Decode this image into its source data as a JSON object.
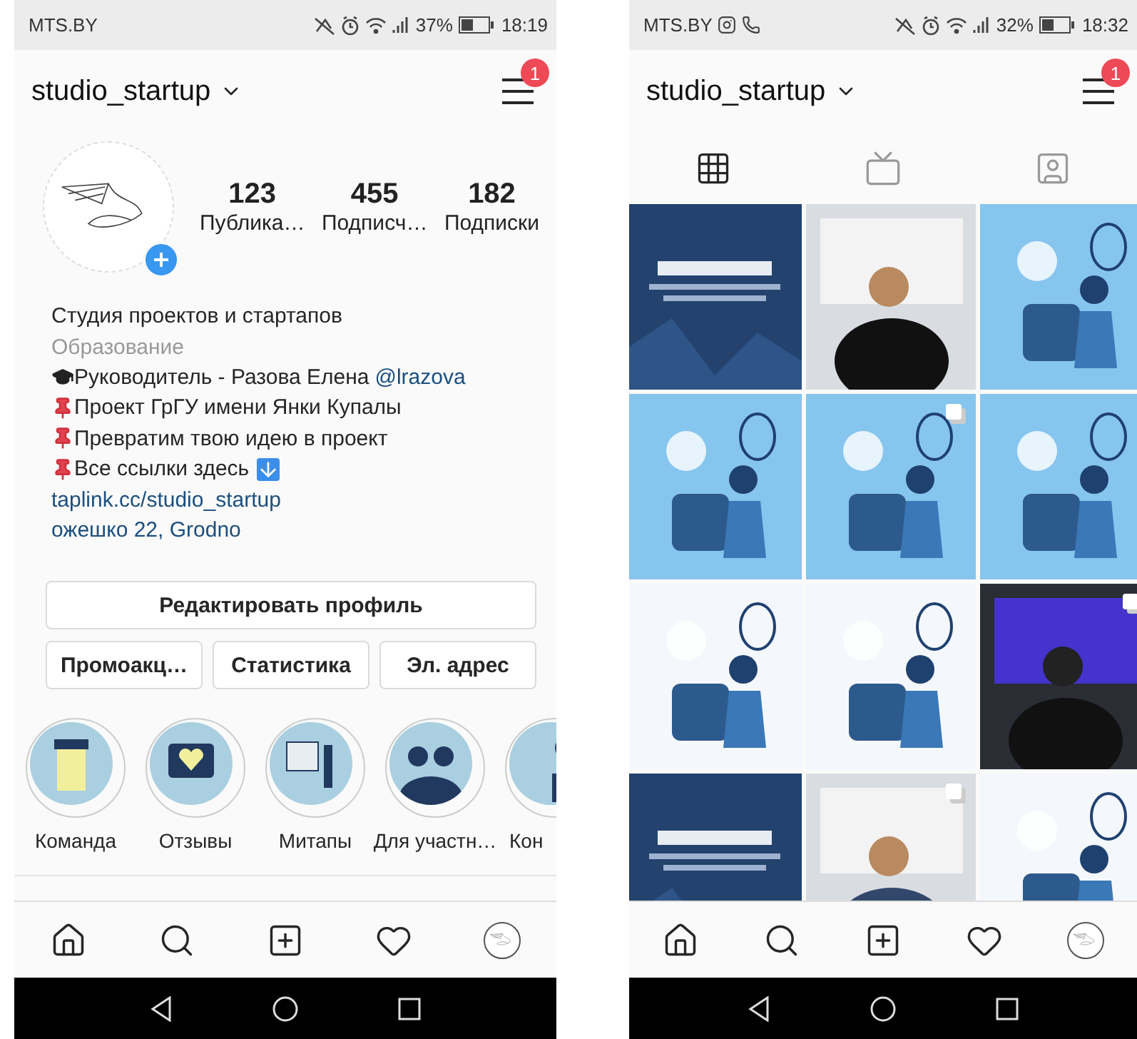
{
  "screens": [
    {
      "kind": "profile",
      "status_bar": {
        "carrier": "MTS.BY",
        "battery": "37%",
        "time": "18:19"
      },
      "header": {
        "username": "studio_startup",
        "badge": "1"
      },
      "stats": [
        {
          "value": "123",
          "label": "Публика…"
        },
        {
          "value": "455",
          "label": "Подписч…"
        },
        {
          "value": "182",
          "label": "Подписки"
        }
      ],
      "bio": [
        {
          "kind": "name",
          "text": "Студия проектов и стартапов"
        },
        {
          "kind": "category",
          "text": "Образование"
        },
        {
          "kind": "lead",
          "text": "Руководитель - Разова Елена",
          "mention": "@lrazova"
        },
        {
          "kind": "bullet",
          "text": "Проект ГрГУ имени Янки Купалы",
          "arrow": false
        },
        {
          "kind": "bullet",
          "text": "Превратим твою идею в проект",
          "arrow": false
        },
        {
          "kind": "bullet",
          "text": "Все ссылки здесь",
          "arrow": true
        },
        {
          "kind": "link",
          "text": "taplink.cc/studio_startup"
        },
        {
          "kind": "link",
          "text": "ожешко 22, Grodno"
        }
      ],
      "edit_button": "Редактировать профиль",
      "buttons": [
        "Промоакц…",
        "Статистика",
        "Эл. адрес"
      ],
      "highlights": [
        {
          "label": "Команда"
        },
        {
          "label": "Отзывы"
        },
        {
          "label": "Митапы"
        },
        {
          "label": "Для участн…"
        },
        {
          "label": "Кон"
        }
      ]
    },
    {
      "kind": "grid",
      "status_bar": {
        "carrier": "MTS.BY",
        "notifications": [
          {
            "kind": "camera"
          },
          {
            "kind": "phone"
          }
        ],
        "battery": "32%",
        "time": "18:32"
      },
      "header": {
        "username": "studio_startup",
        "badge": "1"
      },
      "tabs": [
        {
          "kind": "grid",
          "selected": true
        },
        {
          "kind": "tv",
          "selected": false
        },
        {
          "kind": "tagged",
          "selected": false
        }
      ],
      "posts": [
        {
          "kind": "picture",
          "multiple": false
        },
        {
          "kind": "picture",
          "multiple": false
        },
        {
          "kind": "picture",
          "multiple": false
        },
        {
          "kind": "picture",
          "multiple": false
        },
        {
          "kind": "picture",
          "multiple": true
        },
        {
          "kind": "picture",
          "multiple": false
        },
        {
          "kind": "picture",
          "multiple": false
        },
        {
          "kind": "picture",
          "multiple": false
        },
        {
          "kind": "picture",
          "multiple": true
        },
        {
          "kind": "picture",
          "multiple": false
        },
        {
          "kind": "picture",
          "multiple": true
        },
        {
          "kind": "picture",
          "multiple": false
        }
      ]
    }
  ]
}
